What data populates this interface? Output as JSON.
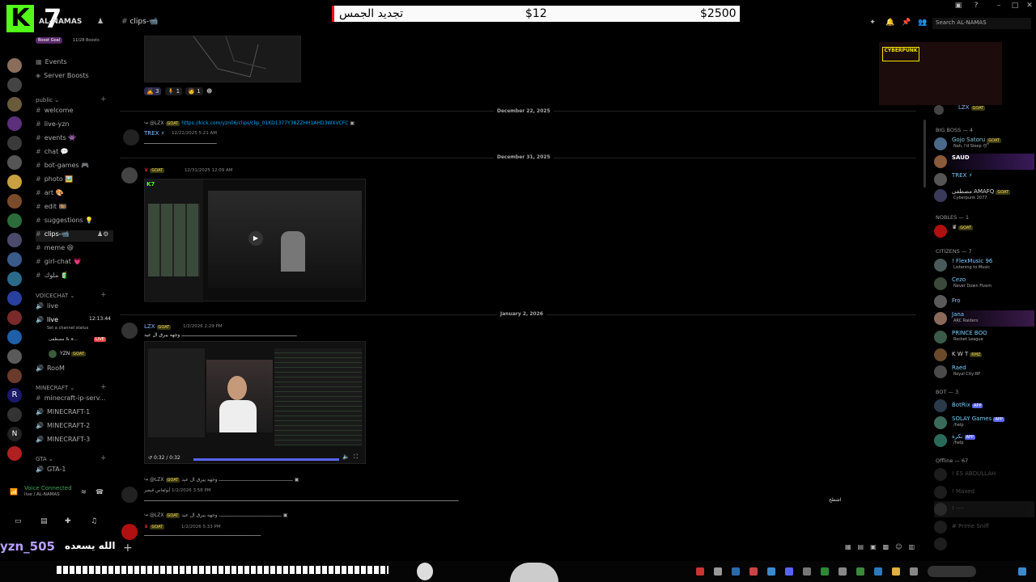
{
  "brand": {
    "letter": "K",
    "number": "7"
  },
  "server": {
    "name": "AL-NAMAS",
    "boost_goal": "Boost Goal",
    "boosts": "11/28 Boosts"
  },
  "channel": {
    "title": "clips-📹"
  },
  "banner": {
    "text_ar": "تجديد الجمس",
    "price1": "$12",
    "price2": "$2500"
  },
  "search": {
    "placeholder": "Search AL-NAMAS"
  },
  "channels": {
    "top_items": [
      "Events",
      "Server Boosts"
    ],
    "public_cat": "public",
    "public": [
      "welcome",
      "live-yzn",
      "events 👾",
      "chat 💬",
      "bot-games 🎮",
      "photo 🖼️",
      "art 🎨",
      "edit 🎞️",
      "suggestions 💡",
      "clips-📹",
      "meme 😆",
      "girl-chat 💗",
      "ملوك 🧃"
    ],
    "voice_cat": "VOICECHAT",
    "voice": [
      {
        "name": "live",
        "time": ""
      },
      {
        "name": "live",
        "time": "12:13:44"
      }
    ],
    "channel_status": "Set a channel status",
    "live_user": "مصطفى & a...",
    "live_badge": "LIVE",
    "yzn": "YZN",
    "goat": "GOAT",
    "room": "RooM",
    "mc_cat": "MINECRAFT",
    "minecraft": [
      "minecraft-ip-serv...",
      "MINECRAFT-1",
      "MINECRAFT-2",
      "MINECRAFT-3"
    ],
    "gta_cat": "GTA",
    "gta": [
      "GTA-1"
    ]
  },
  "voice_status": {
    "title": "Voice Connected",
    "sub": "live / AL-NAMAS"
  },
  "watermark": {
    "name": "yzn_505",
    "ar": "الله يسعده"
  },
  "messages": {
    "reactions": [
      "3",
      "1",
      "1"
    ],
    "date1": "December 22, 2025",
    "m1_user": "@LZX",
    "m1_link": "https://kick.com/yzn06/clips/clip_01KD1377Y38ZZHH1AHD3WXVCFC",
    "m1_sender": "TREX ⚡",
    "m1_ts": "12/22/2025 5:21 AM",
    "m1_text": "ـــــــــــــــــــــــــــــــــــــــــــــــــــ",
    "date2": "December 31, 2025",
    "m2_ts": "12/31/2025 12:09 AM",
    "date3": "January 2, 2026",
    "m3_user": "LZX",
    "m3_ts": "1/2/2026 2:29 PM",
    "m3_text": "وجهه يبرق ال عيد",
    "video_time": "0:32 / 0:32",
    "m4_user": "@LZX",
    "m4_sender": "أبولفاس قيصر",
    "m4_ts": "1/2/2026 3:58 PM",
    "m4_text_end": "اشطح",
    "m5_user": "@LZX",
    "m5_ts": "1/2/2026 5:33 PM"
  },
  "members": {
    "top_user": "LZX",
    "goat": "GOAT",
    "big_boss": "BIG BOSS — 4",
    "bigboss_list": [
      {
        "name": "Gojo Satoru",
        "status": "Nah, I'd Sleep 😴"
      },
      {
        "name": "SAUD",
        "status": ""
      },
      {
        "name": "TREX ⚡",
        "status": ""
      },
      {
        "name": "مصطفى AMAFQ",
        "status": "Cyberpunk 2077"
      }
    ],
    "nobles": "NOBLES — 1",
    "nobles_list": [
      {
        "name": "",
        "status": ""
      }
    ],
    "citizens": "CITIZENS — 7",
    "citizens_list": [
      {
        "name": "! FlexMusic 96",
        "status": "Listening to Music"
      },
      {
        "name": "Cezo",
        "status": "Never Down Fivem"
      },
      {
        "name": "Fro",
        "status": ""
      },
      {
        "name": "Jana",
        "status": "ARC Raiders"
      },
      {
        "name": "PRINCE BOO",
        "status": "Rocket League"
      },
      {
        "name": "K W T",
        "status": ""
      },
      {
        "name": "Raed",
        "status": "Royal City RP"
      }
    ],
    "bot": "BOT — 3",
    "bot_list": [
      {
        "name": "BotRix",
        "status": "",
        "tag": "APP"
      },
      {
        "name": "SOLAY Games",
        "status": "/help",
        "tag": "APP"
      },
      {
        "name": "بكرة",
        "status": "/help",
        "tag": "APP"
      }
    ],
    "offline": "Offline — 67",
    "offline_list": [
      {
        "name": "! ES ABDULLAH"
      },
      {
        "name": "! Maxed"
      },
      {
        "name": "! ----"
      },
      {
        "name": "# Prime Sniff"
      },
      {
        "name": ""
      }
    ]
  },
  "colors": {
    "accent": "#53fc18",
    "banner_border": "#ee1111",
    "link": "#00a8fc",
    "live": "#ed4245"
  }
}
